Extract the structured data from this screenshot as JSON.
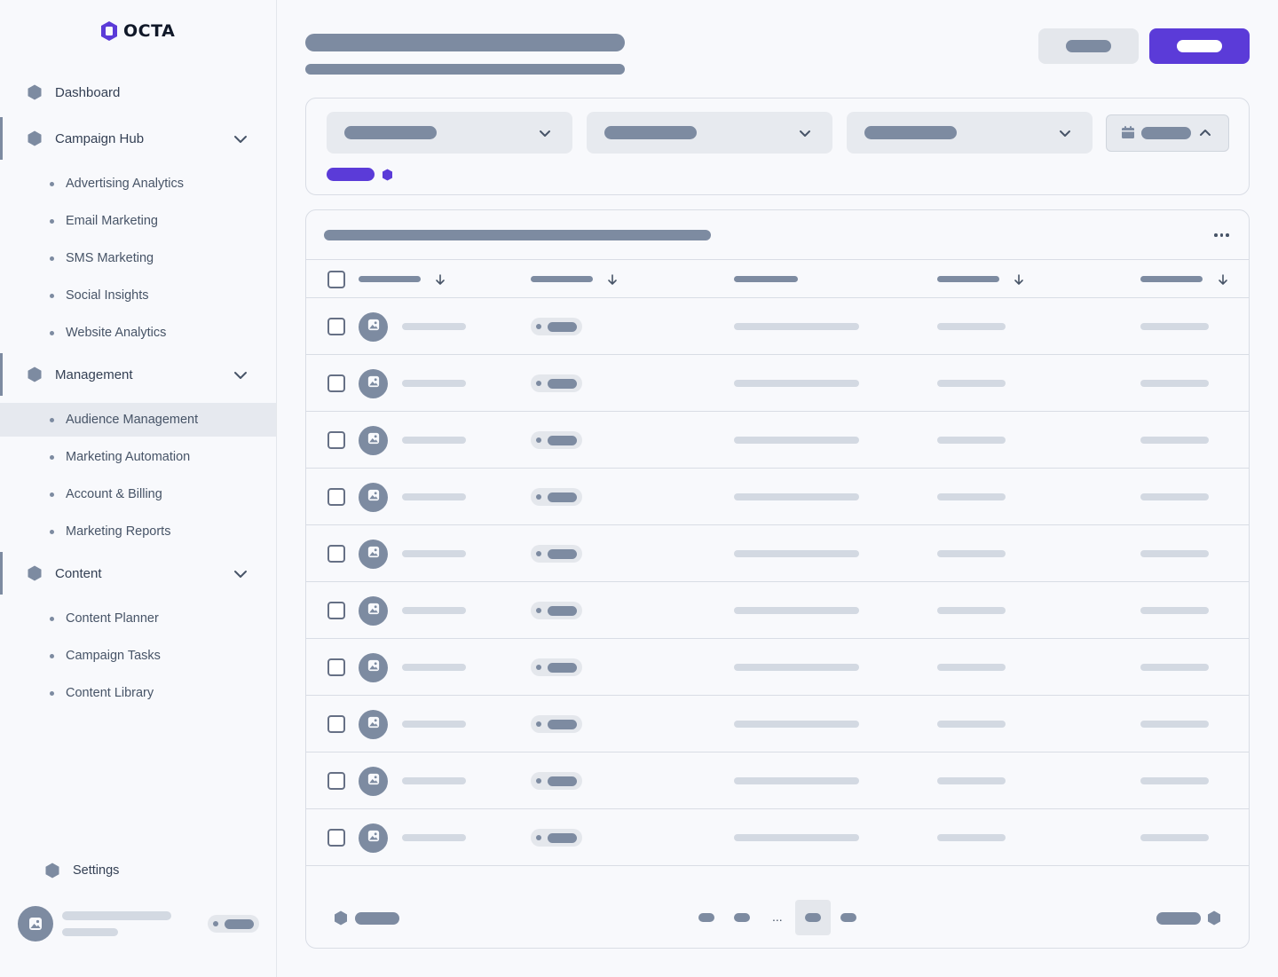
{
  "brand": {
    "name": "OCTA",
    "accent": "#5b3bd8"
  },
  "sidebar": {
    "dashboard": "Dashboard",
    "groups": [
      {
        "label": "Campaign Hub",
        "icon": "hexagon-icon",
        "items": [
          "Advertising Analytics",
          "Email Marketing",
          "SMS Marketing",
          "Social Insights",
          "Website Analytics"
        ]
      },
      {
        "label": "Management",
        "icon": "hexagon-icon",
        "items": [
          "Audience Management",
          "Marketing Automation",
          "Account & Billing",
          "Marketing Reports"
        ]
      },
      {
        "label": "Content",
        "icon": "hexagon-icon",
        "items": [
          "Content Planner",
          "Campaign Tasks",
          "Content Library"
        ]
      }
    ],
    "active_item": "Audience Management",
    "settings": "Settings"
  },
  "pagination": {
    "ellipsis": "..."
  },
  "table": {
    "row_count": 10
  }
}
